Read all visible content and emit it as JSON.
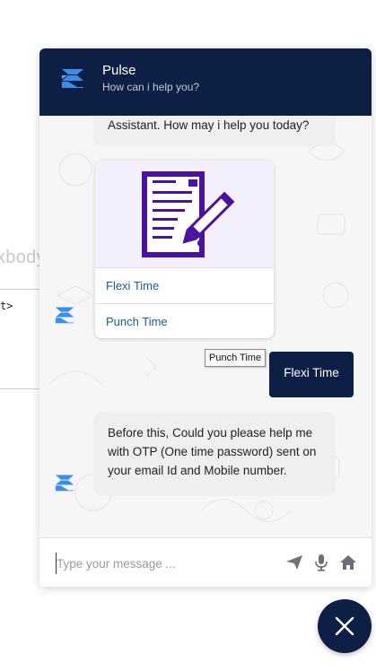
{
  "background": {
    "partial_word": "kbody",
    "panel_text": "t>"
  },
  "header": {
    "title": "Pulse",
    "subtitle": "How can i help you?",
    "logo_icon": "pulse-logo-icon",
    "color": "#0d1f45"
  },
  "messages": {
    "bot_greeting": "Assistant. How may i help you today?",
    "card_options": [
      "Flexi Time",
      "Punch Time"
    ],
    "tooltip": "Punch Time",
    "user_reply": "Flexi Time",
    "bot_otp_line1": "Before this, Could you please help me",
    "bot_otp_line2": "with OTP (One time password) sent on",
    "bot_otp_line3": "your email Id and Mobile number."
  },
  "input": {
    "placeholder": "Type your message ...",
    "value": "",
    "icons": [
      "send-icon",
      "microphone-icon",
      "home-icon"
    ]
  },
  "fab": {
    "icon": "close-icon"
  },
  "colors": {
    "accent": "#0d1f45",
    "bot_bubble": "#efeff0",
    "link": "#1e5d8c",
    "logo_blue": "#3a8ee6"
  }
}
